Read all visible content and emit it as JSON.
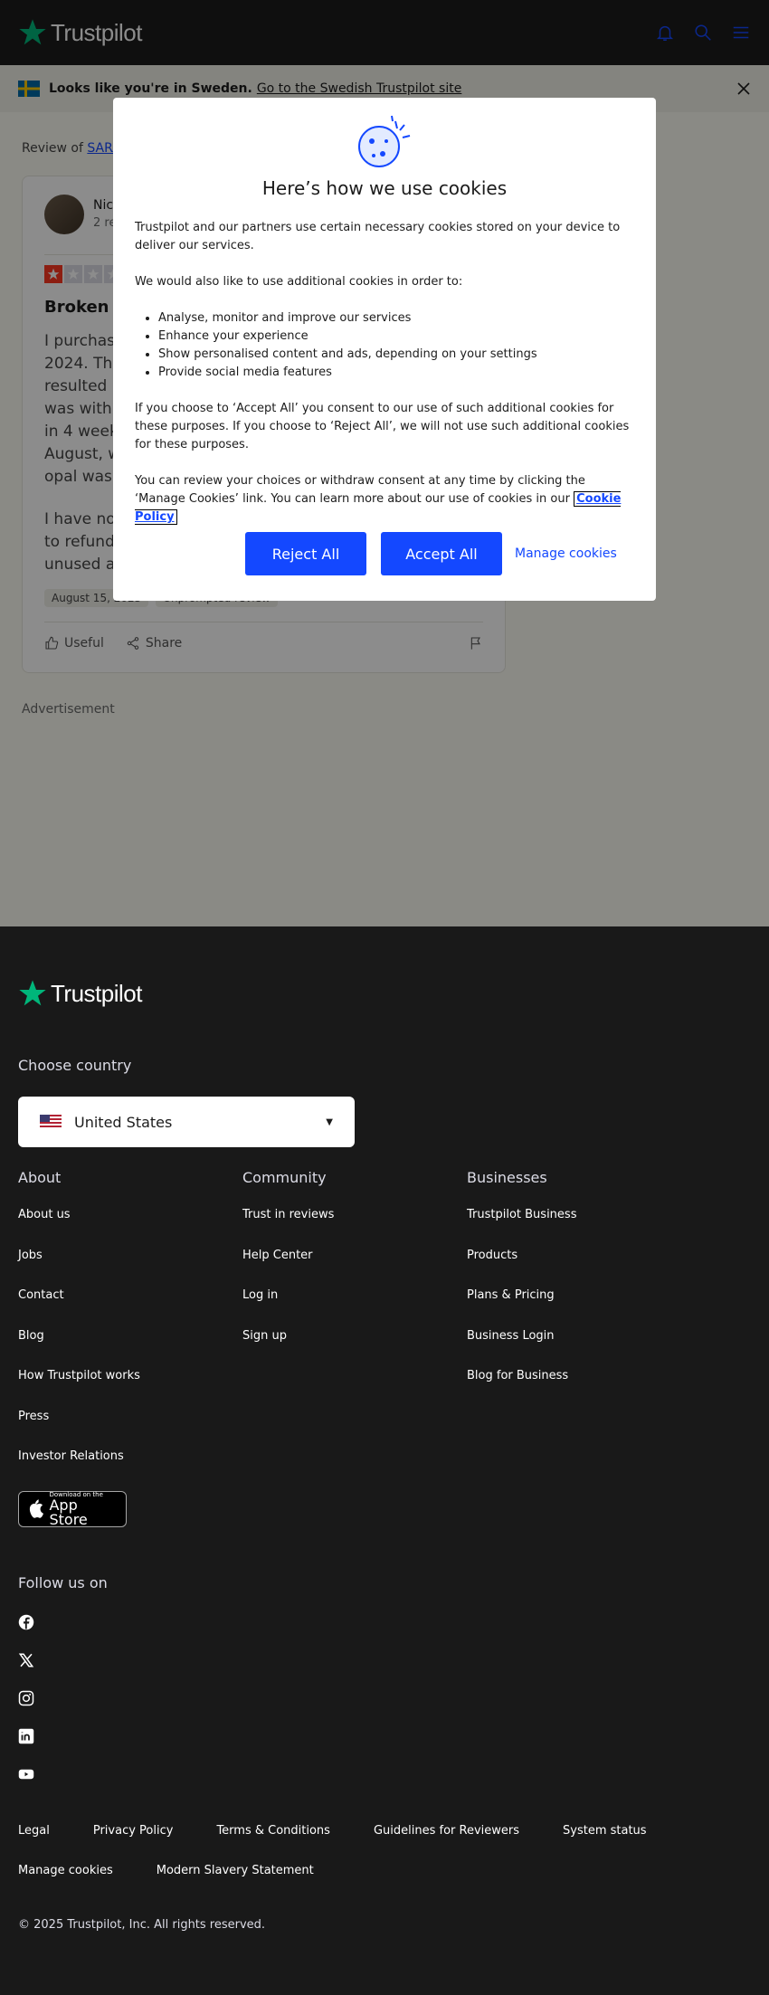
{
  "header": {
    "logo_text": "Trustpilot"
  },
  "banner": {
    "bold_text": "Looks like you're in Sweden.",
    "link_text": "Go to the Swedish Trustpilot site"
  },
  "breadcrumb": {
    "prefix": "Review of",
    "company": "SARA"
  },
  "review": {
    "name": "Nic",
    "count": "2 re",
    "rating": 1,
    "title": "Broken rin",
    "paragraphs": [
      "I purchase\n2024. The\nresulted in\nwas within\nin 4 weeks\nAugust, wh\nopal was lo",
      "I have no c\nto refund a\nunused an"
    ],
    "date": "August 15, 2025",
    "tag": "Unprompted review",
    "useful_label": "Useful",
    "share_label": "Share"
  },
  "advertisement": "Advertisement",
  "cookie_modal": {
    "title": "Here’s how we use cookies",
    "p1": "Trustpilot and our partners use certain necessary cookies stored on your device to deliver our services.",
    "p2": "We would also like to use additional cookies in order to:",
    "list": [
      "Analyse, monitor and improve our services",
      "Enhance your experience",
      "Show personalised content and ads, depending on your settings",
      "Provide social media features"
    ],
    "p3": "If you choose to ‘Accept All’ you consent to our use of such additional cookies for these purposes. If you choose to ‘Reject All’, we will not use such additional cookies for these purposes.",
    "p4": "You can review your choices or withdraw consent at any time by clicking the ‘Manage Cookies’ link. You can learn more about our use of cookies in our",
    "policy_link": "Cookie Policy",
    "reject": "Reject All",
    "accept": "Accept All",
    "manage": "Manage cookies"
  },
  "footer": {
    "logo_text": "Trustpilot",
    "choose_country": "Choose country",
    "country": "United States",
    "about": {
      "heading": "About",
      "links": [
        "About us",
        "Jobs",
        "Contact",
        "Blog",
        "How Trustpilot works",
        "Press",
        "Investor Relations"
      ]
    },
    "community": {
      "heading": "Community",
      "links": [
        "Trust in reviews",
        "Help Center",
        "Log in",
        "Sign up"
      ]
    },
    "businesses": {
      "heading": "Businesses",
      "links": [
        "Trustpilot Business",
        "Products",
        "Plans & Pricing",
        "Business Login",
        "Blog for Business"
      ]
    },
    "appstore_small": "Download on the",
    "appstore_big": "App Store",
    "follow": "Follow us on",
    "legal": [
      "Legal",
      "Privacy Policy",
      "Terms & Conditions",
      "Guidelines for Reviewers",
      "System status"
    ],
    "legal2": [
      "Manage cookies",
      "Modern Slavery Statement"
    ],
    "copyright": "© 2025 Trustpilot, Inc. All rights reserved."
  },
  "colors": {
    "brand_green": "#00b67a",
    "accent_blue": "#1448ff",
    "star_red": "#ff3722"
  }
}
